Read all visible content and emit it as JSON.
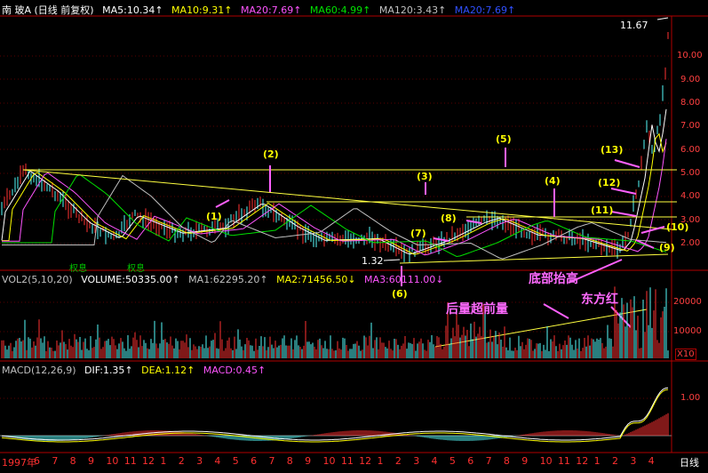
{
  "header": {
    "title": "南  玻A (日线 前复权)",
    "ma": [
      {
        "text": "MA5:10.34↑",
        "color": "#ffffff"
      },
      {
        "text": "MA10:9.31↑",
        "color": "#ffff00"
      },
      {
        "text": "MA20:7.69↑",
        "color": "#ff55ff"
      },
      {
        "text": "MA60:4.99↑",
        "color": "#00e000"
      },
      {
        "text": "MA120:3.43↑",
        "color": "#c0c0c0"
      },
      {
        "text": "MA20:7.69↑",
        "color": "#3050ff"
      }
    ]
  },
  "price": {
    "high_label": "11.67",
    "low_label": "1.32",
    "axis": [
      "10.00",
      "9.00",
      "8.00",
      "7.00",
      "6.00",
      "5.00",
      "4.00",
      "3.00",
      "2.00"
    ],
    "quan_xi": [
      "权息",
      "权息"
    ],
    "labels": [
      "(1)",
      "(2)",
      "(3)",
      "(4)",
      "(5)",
      "(6)",
      "(7)",
      "(8)",
      "(9)",
      "(10)",
      "(11)",
      "(12)",
      "(13)"
    ],
    "notes": {
      "bottom_raise": "底部抬高",
      "red_east": "东方红",
      "volume_note": "后量超前量"
    }
  },
  "volume": {
    "header": [
      {
        "text": "VOL2(5,10,20)",
        "color": "#c0c0c0"
      },
      {
        "text": "VOLUME:50335.00↑",
        "color": "#ffffff"
      },
      {
        "text": "MA1:62295.20↑",
        "color": "#c0c0c0"
      },
      {
        "text": "MA2:71456.50↓",
        "color": "#ffff00"
      },
      {
        "text": "MA3:60111.00↓",
        "color": "#ff55ff"
      }
    ],
    "axis": [
      "20000",
      "10000",
      "X10"
    ]
  },
  "macd": {
    "header": [
      {
        "text": "MACD(12,26,9)",
        "color": "#c0c0c0"
      },
      {
        "text": "DIF:1.35↑",
        "color": "#ffffff"
      },
      {
        "text": "DEA:1.12↑",
        "color": "#ffff00"
      },
      {
        "text": "MACD:0.45↑",
        "color": "#ff55ff"
      }
    ],
    "axis": [
      "1.00"
    ]
  },
  "xaxis": {
    "labels": [
      "1997年",
      "6",
      "7",
      "8",
      "9",
      "10",
      "11",
      "12",
      "1",
      "2",
      "3",
      "4",
      "5",
      "6",
      "7",
      "8",
      "9",
      "10",
      "11",
      "12",
      "1",
      "2",
      "3",
      "4",
      "5",
      "6",
      "7",
      "8",
      "9",
      "10",
      "11",
      "12",
      "1",
      "2",
      "3",
      "4"
    ],
    "period": "日线"
  },
  "colors": {
    "up": "#ff3232",
    "down": "#54fcfc",
    "axis": "#b00000"
  }
}
